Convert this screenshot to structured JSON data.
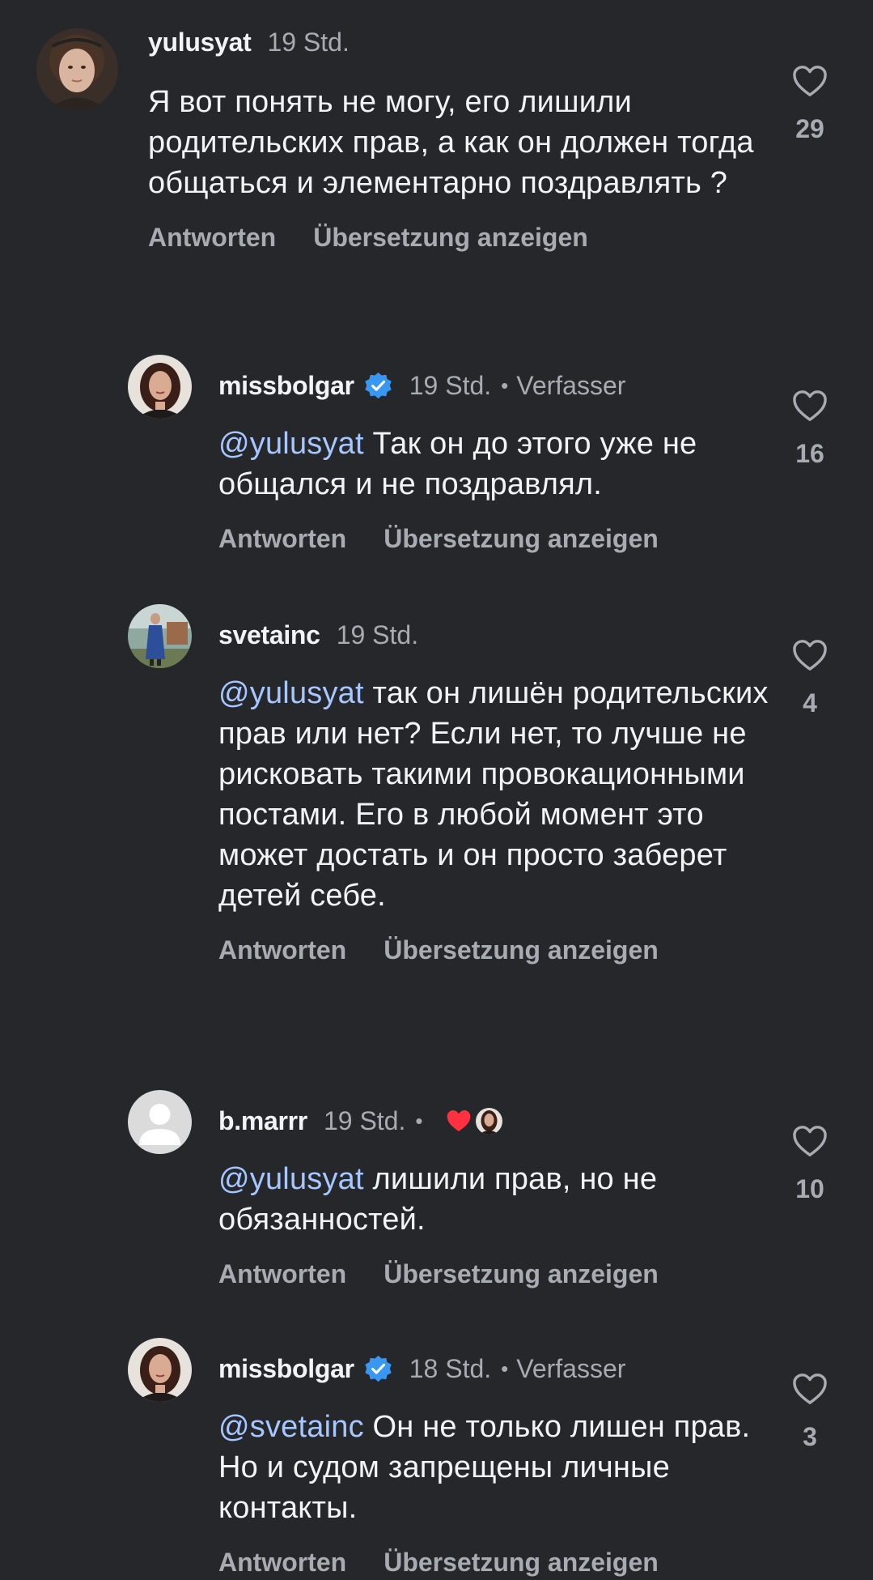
{
  "comments": [
    {
      "username": "yulusyat",
      "time": "19 Std.",
      "text": "Я вот понять не могу, его лишили родительских прав, а как он должен тогда общаться и элементарно поздравлять ?",
      "reply_label": "Antworten",
      "translate_label": "Übersetzung anzeigen",
      "likes": "29"
    },
    {
      "username": "missbolgar",
      "time": "19 Std.",
      "author_label": "Verfasser",
      "mention": "@yulusyat",
      "text": "Так он до этого уже не общался и не поздравлял.",
      "reply_label": "Antworten",
      "translate_label": "Übersetzung anzeigen",
      "likes": "16"
    },
    {
      "username": "svetainc",
      "time": "19 Std.",
      "mention": "@yulusyat",
      "text": "так он лишён родительских прав или нет? Если нет, то лучше не рисковать такими провокационными постами. Его в любой момент это может достать и он просто заберет детей себе.",
      "reply_label": "Antworten",
      "translate_label": "Übersetzung anzeigen",
      "likes": "4"
    },
    {
      "username": "b.marrr",
      "time": "19 Std.",
      "mention": "@yulusyat",
      "text": "лишили прав, но не обязанностей.",
      "reply_label": "Antworten",
      "translate_label": "Übersetzung anzeigen",
      "likes": "10"
    },
    {
      "username": "missbolgar",
      "time": "18 Std.",
      "author_label": "Verfasser",
      "mention": "@svetainc",
      "text": "Он не только лишен прав. Но и судом запрещены личные контакты.",
      "reply_label": "Antworten",
      "translate_label": "Übersetzung anzeigen",
      "likes": "3"
    }
  ],
  "separator": "•",
  "colors": {
    "background": "#25272b",
    "mention": "#a5c6ff",
    "secondary_text": "#a8abb1",
    "verified_badge": "#3897f0",
    "liked_heart": "#ff3040"
  },
  "icons": {
    "like": "heart-outline-icon",
    "verified": "verified-badge-icon",
    "author_liked": "heart-filled-icon"
  }
}
